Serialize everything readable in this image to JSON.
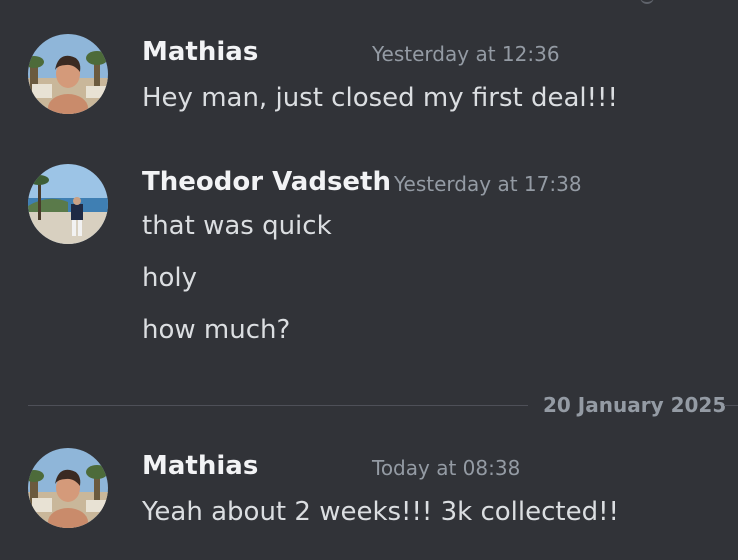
{
  "messages": [
    {
      "author": "Mathias",
      "timestamp": "Yesterday at 12:36",
      "lines": [
        "Hey man, just closed my first deal!!!"
      ]
    },
    {
      "author": "Theodor Vadseth",
      "timestamp": "Yesterday at 17:38",
      "lines": [
        "that was quick",
        "holy",
        "how much?"
      ]
    },
    {
      "author": "Mathias",
      "timestamp": "Today at 08:38",
      "lines": [
        "Yeah about 2 weeks!!! 3k collected!!"
      ]
    }
  ],
  "date_divider": "20 January 2025",
  "colors": {
    "background": "#313338",
    "username": "#f2f3f5",
    "message_text": "#dbdee1",
    "timestamp": "#949ba4",
    "divider": "#4e5058"
  }
}
